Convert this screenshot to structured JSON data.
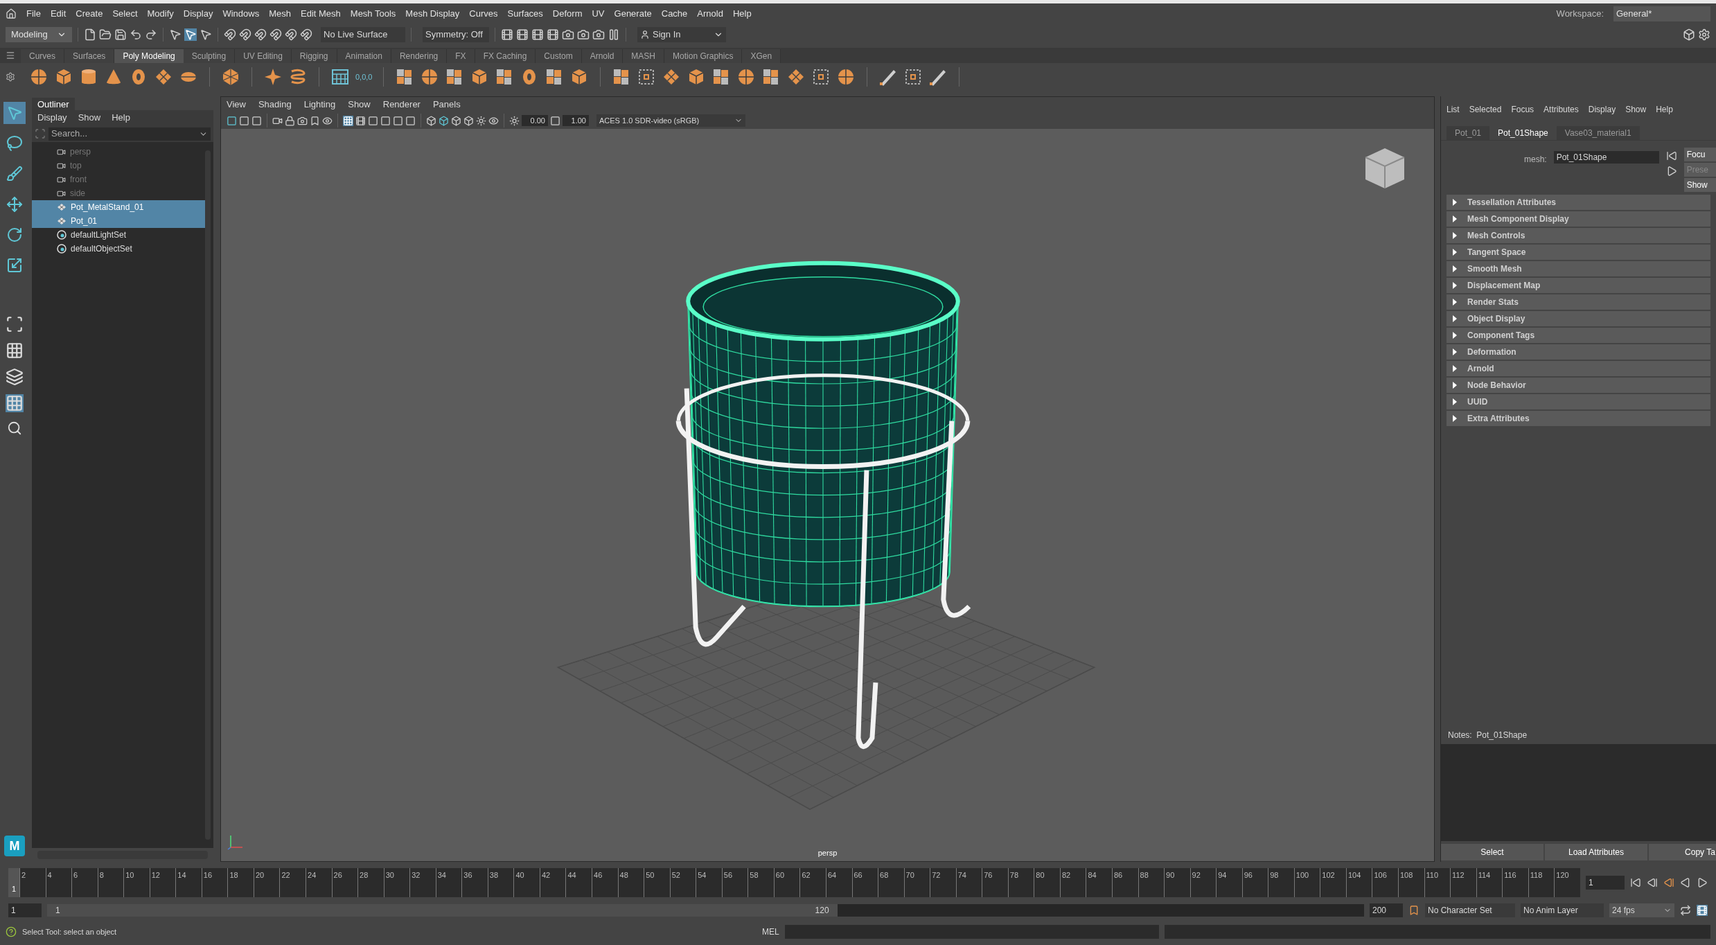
{
  "menu_bar": {
    "items": [
      "File",
      "Edit",
      "Create",
      "Select",
      "Modify",
      "Display",
      "Windows",
      "Mesh",
      "Edit Mesh",
      "Mesh Tools",
      "Mesh Display",
      "Curves",
      "Surfaces",
      "Deform",
      "UV",
      "Generate",
      "Cache",
      "Arnold",
      "Help"
    ],
    "workspace_label": "Workspace:",
    "workspace": "General*"
  },
  "status_line": {
    "mode": "Modeling",
    "live_surface": "No Live Surface",
    "symmetry": "Symmetry: Off",
    "sign_in": "Sign In"
  },
  "shelf": {
    "tabs": [
      {
        "label": "Curves",
        "selected": false
      },
      {
        "label": "Surfaces",
        "selected": false
      },
      {
        "label": "Poly Modeling",
        "selected": true
      },
      {
        "label": "Sculpting",
        "selected": false
      },
      {
        "label": "UV Editing",
        "selected": false
      },
      {
        "label": "Rigging",
        "selected": false
      },
      {
        "label": "Animation",
        "selected": false
      },
      {
        "label": "Rendering",
        "selected": false
      },
      {
        "label": "FX",
        "selected": false
      },
      {
        "label": "FX Caching",
        "selected": false
      },
      {
        "label": "Custom",
        "selected": false
      },
      {
        "label": "Arnold",
        "selected": false
      },
      {
        "label": "MASH",
        "selected": false
      },
      {
        "label": "Motion Graphics",
        "selected": false
      },
      {
        "label": "XGen",
        "selected": false
      }
    ],
    "coords_label": "0,0,0"
  },
  "toolbox": {
    "tools": [
      {
        "kind": "select",
        "selected": true
      },
      {
        "kind": "lasso",
        "selected": false
      },
      {
        "kind": "paint",
        "selected": false
      },
      {
        "kind": "move",
        "selected": false
      },
      {
        "kind": "rotate",
        "selected": false
      },
      {
        "kind": "scale",
        "selected": false
      }
    ],
    "logo_text": "M"
  },
  "outliner": {
    "title": "Outliner",
    "menus": [
      "Display",
      "Show",
      "Help"
    ],
    "search": {
      "placeholder": "Search..."
    },
    "items": [
      {
        "label": "persp",
        "kind": "camera",
        "dimmed": true,
        "selected": false
      },
      {
        "label": "top",
        "kind": "camera",
        "dimmed": true,
        "selected": false
      },
      {
        "label": "front",
        "kind": "camera",
        "dimmed": true,
        "selected": false
      },
      {
        "label": "side",
        "kind": "camera",
        "dimmed": true,
        "selected": false
      },
      {
        "label": "Pot_MetalStand_01",
        "kind": "mesh",
        "dimmed": false,
        "selected": true
      },
      {
        "label": "Pot_01",
        "kind": "mesh",
        "dimmed": false,
        "selected": true
      },
      {
        "label": "defaultLightSet",
        "kind": "set",
        "dimmed": false,
        "selected": false
      },
      {
        "label": "defaultObjectSet",
        "kind": "set",
        "dimmed": false,
        "selected": false
      }
    ]
  },
  "viewport": {
    "menus": [
      "View",
      "Shading",
      "Lighting",
      "Show",
      "Renderer",
      "Panels"
    ],
    "exposure": "0.00",
    "gamma": "1.00",
    "color_space": "ACES 1.0 SDR-video (sRGB)",
    "camera_label": "persp"
  },
  "attribute_editor": {
    "menus": [
      "List",
      "Selected",
      "Focus",
      "Attributes",
      "Display",
      "Show",
      "Help"
    ],
    "tabs": [
      {
        "label": "Pot_01",
        "selected": false
      },
      {
        "label": "Pot_01Shape",
        "selected": true
      },
      {
        "label": "Vase03_material1",
        "selected": false
      }
    ],
    "node_label": "mesh:",
    "node_name": "Pot_01Shape",
    "buttons": [
      {
        "label": "Focu",
        "disabled": false
      },
      {
        "label": "Prese",
        "disabled": true
      },
      {
        "label": "Show",
        "disabled": false
      }
    ],
    "sections": [
      {
        "label": "Tessellation Attributes",
        "expanded": false
      },
      {
        "label": "Mesh Component Display",
        "expanded": false
      },
      {
        "label": "Mesh Controls",
        "expanded": false
      },
      {
        "label": "Tangent Space",
        "expanded": false
      },
      {
        "label": "Smooth Mesh",
        "expanded": false
      },
      {
        "label": "Displacement Map",
        "expanded": false
      },
      {
        "label": "Render Stats",
        "expanded": false
      },
      {
        "label": "Object Display",
        "expanded": false
      },
      {
        "label": "Component Tags",
        "expanded": false
      },
      {
        "label": "Deformation",
        "expanded": false
      },
      {
        "label": "Arnold",
        "expanded": false
      },
      {
        "label": "Node Behavior",
        "expanded": false
      },
      {
        "label": "UUID",
        "expanded": false
      },
      {
        "label": "Extra Attributes",
        "expanded": false
      }
    ],
    "notes_label": "Notes:  Pot_01Shape",
    "bottom_buttons": [
      "Select",
      "Load Attributes",
      "Copy Ta"
    ]
  },
  "time_slider": {
    "current_frame": "1",
    "frame_field": "1",
    "ticks": [
      "2",
      "4",
      "6",
      "8",
      "10",
      "12",
      "14",
      "16",
      "18",
      "20",
      "22",
      "24",
      "26",
      "28",
      "30",
      "32",
      "34",
      "36",
      "38",
      "40",
      "42",
      "44",
      "46",
      "48",
      "50",
      "52",
      "54",
      "56",
      "58",
      "60",
      "62",
      "64",
      "66",
      "68",
      "70",
      "72",
      "74",
      "76",
      "78",
      "80",
      "82",
      "84",
      "86",
      "88",
      "90",
      "92",
      "94",
      "96",
      "98",
      "100",
      "102",
      "104",
      "106",
      "108",
      "110",
      "112",
      "114",
      "116",
      "118",
      "120"
    ]
  },
  "range_slider": {
    "level": 0.6,
    "start": "1",
    "range_start": "1",
    "range_end": "120",
    "end": "200",
    "character_set": "No Character Set",
    "anim_layer": "No Anim Layer",
    "fps": "24 fps"
  },
  "help_line": "Select Tool: select an object",
  "command_line": {
    "language": "MEL"
  }
}
